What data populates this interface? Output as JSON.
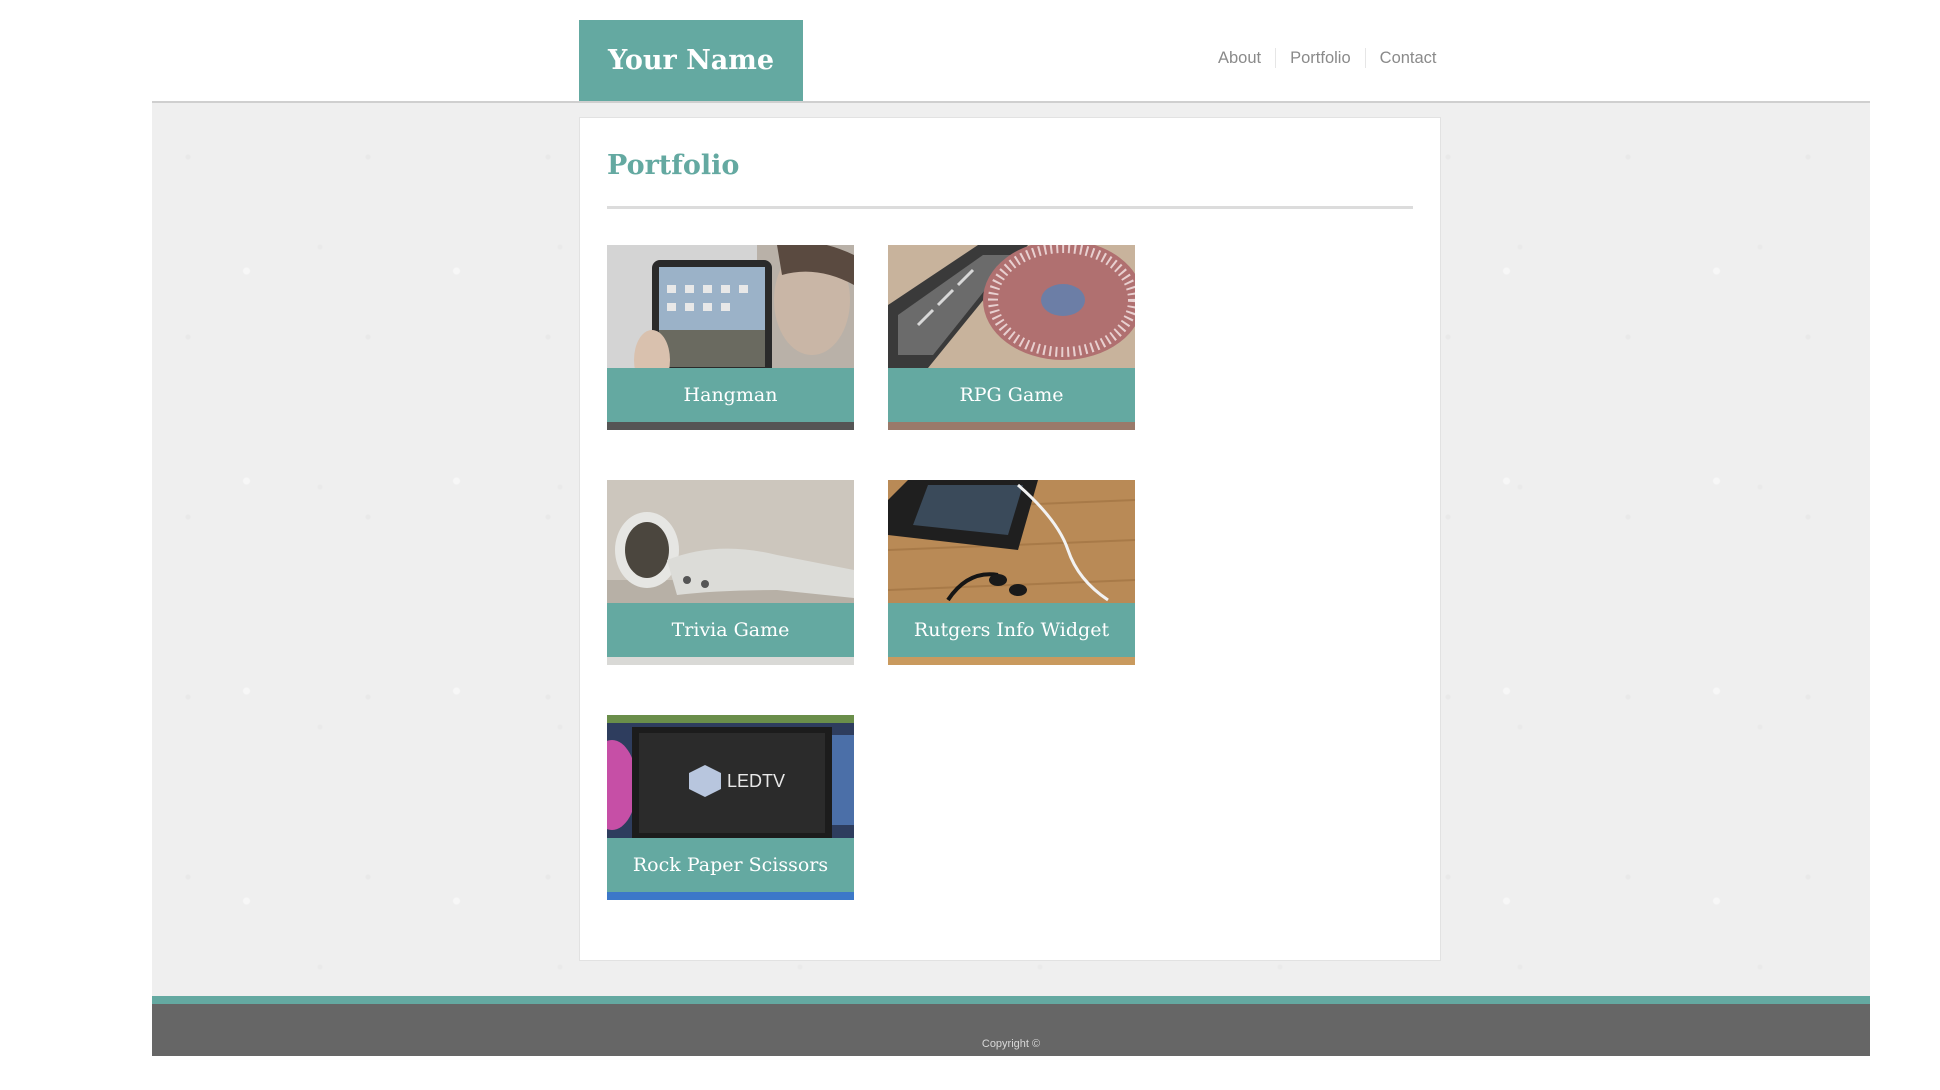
{
  "header": {
    "brand": "Your Name",
    "nav": [
      "About",
      "Portfolio",
      "Contact"
    ]
  },
  "main": {
    "title": "Portfolio",
    "projects": [
      {
        "title": "Hangman",
        "image": "tablet-photo"
      },
      {
        "title": "RPG Game",
        "image": "turntable-photo"
      },
      {
        "title": "Trivia Game",
        "image": "earbuds-photo"
      },
      {
        "title": "Rutgers Info Widget",
        "image": "phone-earphones-photo"
      },
      {
        "title": "Rock Paper Scissors",
        "image": "led-tv-photo"
      }
    ],
    "tv_screen_text": "LEDTV"
  },
  "footer": {
    "copyright": "Copyright ©"
  },
  "colors": {
    "accent": "#64a9a1",
    "footer": "#666666",
    "nav_text": "#8a8a8a",
    "background": "#efefef"
  }
}
